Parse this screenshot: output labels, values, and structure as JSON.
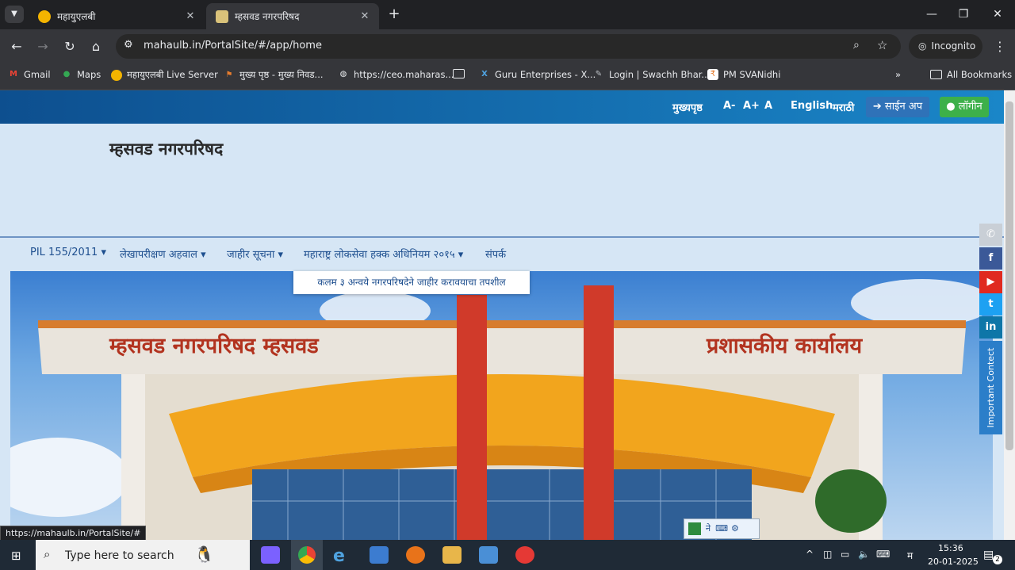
{
  "browser": {
    "tabs": [
      {
        "title": "महायुएलबी",
        "close": "✕"
      },
      {
        "title": "म्हसवड नगरपरिषद",
        "close": "✕"
      }
    ],
    "new_tab": "+",
    "window_controls": {
      "minimize": "—",
      "maximize": "❐",
      "close": "✕"
    },
    "url": "mahaulb.in/PortalSite/#/app/home",
    "incognito_label": "Incognito",
    "bookmarks": [
      {
        "label": "Gmail",
        "icon": "gmail-icon"
      },
      {
        "label": "Maps",
        "icon": "maps-icon"
      },
      {
        "label": "महायुएलबी Live Server",
        "icon": "mahaulb-icon"
      },
      {
        "label": "मुख्य पृष्ठ - मुख्य निवड...",
        "icon": "flag-icon"
      },
      {
        "label": "https://ceo.maharas...",
        "icon": "globe-icon"
      },
      {
        "label": "",
        "icon": "folder-icon"
      },
      {
        "label": "Guru Enterprises - X...",
        "icon": "x-icon"
      },
      {
        "label": "Login | Swachh Bhar...",
        "icon": "swachh-icon"
      },
      {
        "label": "PM SVANidhi",
        "icon": "svanidhi-icon"
      }
    ],
    "more_bookmarks": "»",
    "all_bookmarks": "All Bookmarks"
  },
  "page": {
    "topbar": {
      "home": "मुख्यपृष्ठ",
      "font_small": "A-",
      "font_large": "A+",
      "font_normal": "A",
      "english": "English",
      "marathi": "मराठी",
      "signup": "साईन अप",
      "login": "लॉगीन"
    },
    "site_title": "म्हसवड नगरपरिषद",
    "menu": [
      "PIL 155/2011 ▾",
      "लेखापरीक्षण अहवाल ▾",
      "जाहीर सूचना ▾",
      "महाराष्ट्र लोकसेवा हक्क अधिनियम २०१५ ▾",
      "संपर्क"
    ],
    "dropdown_item": "कलम ३ अन्वये नगरपरिषदेने जाहीर करावयाचा तपशील",
    "banner_signs": {
      "left": "म्हसवड नगरपरिषद म्हसवड",
      "right": "प्रशासकीय कार्यालय"
    },
    "social": [
      {
        "icon": "phone-icon",
        "glyph": "✆",
        "color": "#c9cfd6"
      },
      {
        "icon": "facebook-icon",
        "glyph": "f",
        "color": "#3b5998"
      },
      {
        "icon": "youtube-icon",
        "glyph": "▶",
        "color": "#e02a20"
      },
      {
        "icon": "twitter-icon",
        "glyph": "t",
        "color": "#1da1f2"
      },
      {
        "icon": "linkedin-icon",
        "glyph": "in",
        "color": "#0e76a8"
      }
    ],
    "important_contact": "Important Contect",
    "status_url": "https://mahaulb.in/PortalSite/#",
    "ime_label": "ने"
  },
  "taskbar": {
    "search_placeholder": "Type here to search",
    "time": "15:36",
    "date": "20-01-2025",
    "lang": "म",
    "notifications": "2"
  }
}
